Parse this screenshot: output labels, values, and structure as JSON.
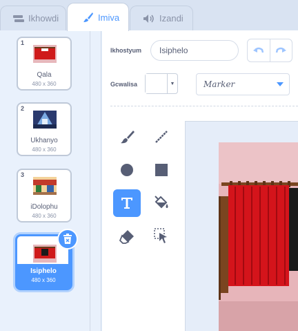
{
  "tabs": {
    "code": "Ikhowdi",
    "costumes": "Imiva",
    "sounds": "Izandi"
  },
  "costumes": [
    {
      "number": "1",
      "name": "Qala",
      "size": "480 x 360"
    },
    {
      "number": "2",
      "name": "Ukhanyo",
      "size": "480 x 360"
    },
    {
      "number": "3",
      "name": "iDolophu",
      "size": "480 x 360"
    },
    {
      "number": "4",
      "name": "Isiphelo",
      "size": "480 x 360"
    }
  ],
  "editor": {
    "costume_label": "Ikhostyum",
    "costume_name": "Isiphelo",
    "fill_label": "Gcwalisa",
    "font_name": "Marker"
  },
  "colors": {
    "accent": "#4c97ff",
    "background": "#e5f0ff"
  }
}
